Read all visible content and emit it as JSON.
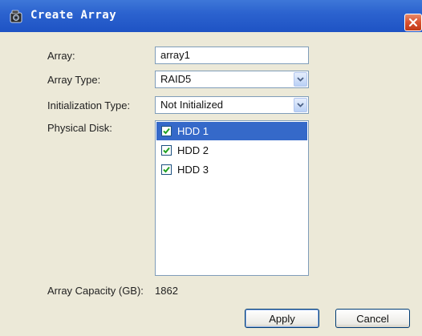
{
  "window": {
    "title": "Create Array",
    "icon": "camera-icon",
    "close_label": "X"
  },
  "form": {
    "array_label": "Array:",
    "array_value": "array1",
    "array_type_label": "Array Type:",
    "array_type_value": "RAID5",
    "init_type_label": "Initialization Type:",
    "init_type_value": "Not Initialized",
    "physical_disk_label": "Physical Disk:",
    "capacity_label": "Array Capacity (GB):",
    "capacity_value": "1862"
  },
  "disks": [
    {
      "label": "HDD 1",
      "checked": true,
      "selected": true
    },
    {
      "label": "HDD 2",
      "checked": true,
      "selected": false
    },
    {
      "label": "HDD 3",
      "checked": true,
      "selected": false
    }
  ],
  "buttons": {
    "apply": "Apply",
    "cancel": "Cancel"
  },
  "colors": {
    "titlebar": "#2c63cf",
    "selection": "#3569c9",
    "check": "#21a121"
  }
}
